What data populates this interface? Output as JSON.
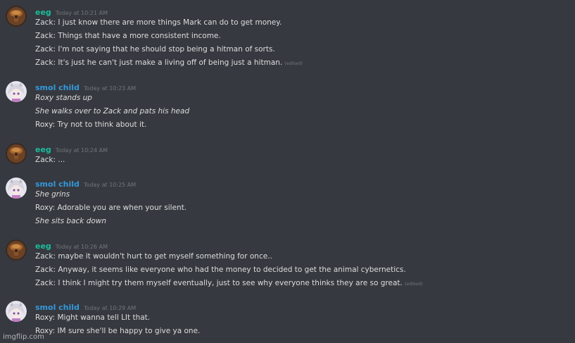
{
  "colors": {
    "background": "#36393f",
    "eeg_name": "#1abc9c",
    "smol_child_name": "#3498db",
    "message_text": "#dcddde",
    "timestamp": "#72767d"
  },
  "groups": [
    {
      "author": "eeg",
      "avatar_icon": "wooden-bird-avatar-icon",
      "timestamp": "Today at 10:21 AM",
      "lines": [
        {
          "text": "Zack: I just know there are more things Mark can do to get money."
        },
        {
          "text": "Zack: Things that have a more consistent income."
        },
        {
          "text": "Zack: I'm not saying that he should stop being a hitman of sorts."
        },
        {
          "text": "Zack: It's just he can't just make a living off of being just a hitman.",
          "edited": "(edited)"
        }
      ]
    },
    {
      "author": "smol child",
      "avatar_icon": "anime-girl-avatar-icon",
      "timestamp": "Today at 10:23 AM",
      "lines": [
        {
          "text": "Roxy stands up",
          "italic": true
        },
        {
          "text": "She walks over to Zack and pats his head",
          "italic": true
        },
        {
          "text": "Roxy: Try not to think about it."
        }
      ]
    },
    {
      "author": "eeg",
      "avatar_icon": "wooden-bird-avatar-icon",
      "timestamp": "Today at 10:24 AM",
      "lines": [
        {
          "text": "Zack: ..."
        }
      ]
    },
    {
      "author": "smol child",
      "avatar_icon": "anime-girl-avatar-icon",
      "timestamp": "Today at 10:25 AM",
      "lines": [
        {
          "text": "She grins",
          "italic": true
        },
        {
          "text": "Roxy: Adorable you are when your silent."
        },
        {
          "text": "She sits back down",
          "italic": true
        }
      ]
    },
    {
      "author": "eeg",
      "avatar_icon": "wooden-bird-avatar-icon",
      "timestamp": "Today at 10:26 AM",
      "lines": [
        {
          "text": "Zack: maybe it wouldn't hurt to get myself something for once.."
        },
        {
          "text": "Zack: Anyway, it seems like everyone who had the money to decided to get the animal cybernetics."
        },
        {
          "text": "Zack: I think I might try them myself eventually, just to see why everyone thinks they are so great.",
          "edited": "(edited)"
        }
      ]
    },
    {
      "author": "smol child",
      "avatar_icon": "anime-girl-avatar-icon",
      "timestamp": "Today at 10:29 AM",
      "lines": [
        {
          "text": "Roxy: Might wanna tell LIt that."
        },
        {
          "text": "Roxy: IM sure she'll be happy to give ya one."
        }
      ]
    }
  ],
  "watermark": "imgflip.com"
}
